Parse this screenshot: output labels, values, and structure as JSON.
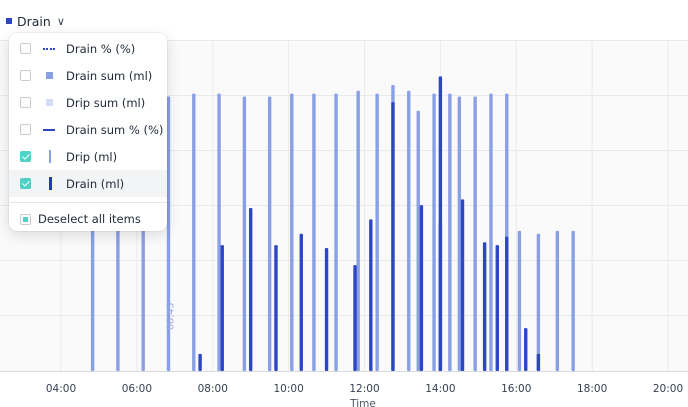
{
  "header": {
    "series_label": "Drain"
  },
  "menu": {
    "items": [
      {
        "label": "Drain % (%)",
        "checked": false,
        "icon": "dotted-line-icon"
      },
      {
        "label": "Drain sum (ml)",
        "checked": false,
        "icon": "square-icon"
      },
      {
        "label": "Drip sum (ml)",
        "checked": false,
        "icon": "light-square-icon"
      },
      {
        "label": "Drain sum % (%)",
        "checked": false,
        "icon": "solid-line-icon"
      },
      {
        "label": "Drip (ml)",
        "checked": true,
        "icon": "light-bar-icon"
      },
      {
        "label": "Drain (ml)",
        "checked": true,
        "icon": "dark-bar-icon"
      }
    ],
    "deselect_label": "Deselect all items"
  },
  "colors": {
    "drip": "#8aa0e6",
    "drain": "#2d46c2",
    "accent": "#4fd1c5"
  },
  "chart_data": {
    "type": "bar",
    "xlabel": "Time",
    "x_ticks": [
      "04:00",
      "06:00",
      "08:00",
      "10:00",
      "12:00",
      "14:00",
      "16:00",
      "18:00",
      "20:00"
    ],
    "x_range": [
      "03:00",
      "20:00"
    ],
    "y_range": [
      0,
      100
    ],
    "annotation": "06:45",
    "grid": true,
    "series": [
      {
        "name": "Drip (ml)",
        "points": [
          {
            "t": "04:50",
            "v": 96
          },
          {
            "t": "05:30",
            "v": 96
          },
          {
            "t": "06:10",
            "v": 96
          },
          {
            "t": "06:50",
            "v": 96
          },
          {
            "t": "07:30",
            "v": 97
          },
          {
            "t": "08:10",
            "v": 97
          },
          {
            "t": "08:50",
            "v": 96
          },
          {
            "t": "09:30",
            "v": 96
          },
          {
            "t": "10:05",
            "v": 97
          },
          {
            "t": "10:40",
            "v": 97
          },
          {
            "t": "11:15",
            "v": 97
          },
          {
            "t": "11:50",
            "v": 98
          },
          {
            "t": "12:20",
            "v": 97
          },
          {
            "t": "12:45",
            "v": 100
          },
          {
            "t": "13:10",
            "v": 98
          },
          {
            "t": "13:25",
            "v": 91
          },
          {
            "t": "13:50",
            "v": 97
          },
          {
            "t": "14:15",
            "v": 97
          },
          {
            "t": "14:30",
            "v": 96
          },
          {
            "t": "14:55",
            "v": 96
          },
          {
            "t": "15:20",
            "v": 97
          },
          {
            "t": "15:45",
            "v": 97
          },
          {
            "t": "16:05",
            "v": 49
          },
          {
            "t": "16:35",
            "v": 48
          },
          {
            "t": "17:05",
            "v": 49
          },
          {
            "t": "17:30",
            "v": 49
          }
        ]
      },
      {
        "name": "Drain (ml)",
        "points": [
          {
            "t": "07:40",
            "v": 6
          },
          {
            "t": "08:15",
            "v": 44
          },
          {
            "t": "09:00",
            "v": 57
          },
          {
            "t": "09:40",
            "v": 44
          },
          {
            "t": "10:20",
            "v": 48
          },
          {
            "t": "11:00",
            "v": 43
          },
          {
            "t": "11:45",
            "v": 37
          },
          {
            "t": "12:10",
            "v": 53
          },
          {
            "t": "12:45",
            "v": 94
          },
          {
            "t": "13:30",
            "v": 58
          },
          {
            "t": "14:00",
            "v": 52
          },
          {
            "t": "14:00",
            "v": 103
          },
          {
            "t": "14:35",
            "v": 60
          },
          {
            "t": "15:10",
            "v": 45
          },
          {
            "t": "15:30",
            "v": 44
          },
          {
            "t": "15:45",
            "v": 47
          },
          {
            "t": "16:15",
            "v": 15
          },
          {
            "t": "16:35",
            "v": 6
          }
        ]
      }
    ]
  }
}
